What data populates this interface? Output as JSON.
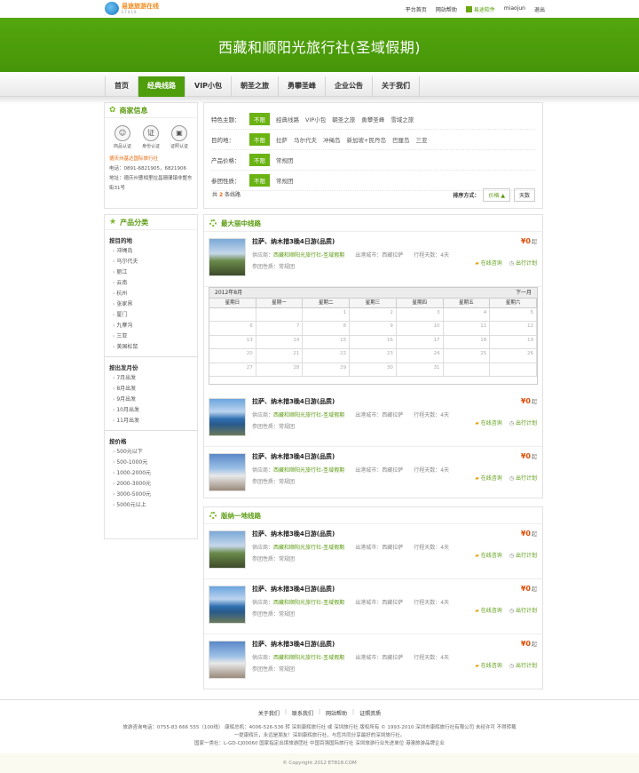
{
  "logo": {
    "name": "易途旅游在线",
    "sub": "ET818"
  },
  "toplinks": [
    "平台首页",
    "网站帮助",
    "易途软件",
    "miaojun",
    "退出"
  ],
  "banner": "西藏和顺阳光旅行社(圣域假期)",
  "nav": [
    "首页",
    "经典线路",
    "VIP小包",
    "朝圣之旅",
    "勇攀圣峰",
    "企业公告",
    "关于我们"
  ],
  "merchant": {
    "title": "商家信息",
    "certs": [
      "商品认证",
      "身份认证",
      "证照认证"
    ],
    "name": "德庆州基达国际旅行社",
    "phone": "电话：0891-6821905，6821906",
    "addr": "地址：德庆州曹相里拉昌珊珊镇非整东街31号"
  },
  "filters": [
    {
      "label": "特色主题：",
      "nolimit": "不限",
      "items": [
        "经典线路",
        "VIP小包",
        "朝圣之旅",
        "勇攀圣峰",
        "雪域之旅"
      ]
    },
    {
      "label": "目的地：",
      "nolimit": "不限",
      "items": [
        "拉萨",
        "马尔代夫",
        "冲绳岛",
        "新加坡+民丹岛",
        "巴厘岛",
        "三亚"
      ]
    },
    {
      "label": "产品价格：",
      "nolimit": "不限",
      "items": [
        "常规团"
      ]
    },
    {
      "label": "参团性质：",
      "nolimit": "不限",
      "items": [
        "常规团"
      ]
    }
  ],
  "count": {
    "pre": "共",
    "num": "2",
    "post": "条线路"
  },
  "sort": {
    "label": "排序方式：",
    "price": "价格",
    "days": "天数"
  },
  "categories": {
    "title": "产品分类",
    "groups": [
      {
        "h": "按目的地",
        "items": [
          "冲绳岛",
          "马尔代夫",
          "丽江",
          "云南",
          "杭州",
          "张家界",
          "厦门",
          "九寨沟",
          "三亚",
          "美国松鼠"
        ]
      },
      {
        "h": "按出发月份",
        "items": [
          "7月出发",
          "8月出发",
          "9月出发",
          "10月出发",
          "11月出发"
        ]
      },
      {
        "h": "按价格",
        "items": [
          "500元以下",
          "500-1000元",
          "1000-2000元",
          "2000-3000元",
          "3000-5000元",
          "5000元以上"
        ]
      }
    ]
  },
  "sections": [
    {
      "title": "最大丽中线路",
      "calendar": {
        "month": "2012年8月",
        "next": "下一月",
        "week": [
          "星期日",
          "星期一",
          "星期二",
          "星期三",
          "星期四",
          "星期五",
          "星期六"
        ],
        "days": [
          "",
          "",
          "1",
          "2",
          "3",
          "4",
          "5",
          "6",
          "7",
          "8",
          "9",
          "10",
          "11",
          "12",
          "13",
          "14",
          "15",
          "16",
          "17",
          "18",
          "19",
          "20",
          "21",
          "22",
          "23",
          "24",
          "25",
          "26",
          "27",
          "28",
          "29",
          "30",
          "31",
          "",
          ""
        ]
      }
    },
    {
      "title": "版纳一地线路"
    }
  ],
  "product": {
    "title": "拉萨、纳木措3晚4日游(品质)",
    "sup_label": "供应商：",
    "sup": "西藏和顺阳光旅行社-圣域假期",
    "city": "出港城市：西藏拉萨",
    "days": "行程天数：4天",
    "nature": "参团性质：常规团",
    "price": "¥0",
    "qi": "起",
    "consult": "在线咨询",
    "plan": "出行计划"
  },
  "footer": {
    "links": [
      "关于我们",
      "联系我们",
      "网站帮助",
      "证照资质"
    ],
    "l1": "旅游咨询电话：0755-83 666 555（100线） 康辉总机：4006-526-536 转 深圳康辉旅行社 或 深圳旅行社 版权所有 © 1993-2010 深圳市康辉旅行社有限公司 未经许可 不得转载",
    "l2": "一提康辉乐，永远是朋友！深圳康辉旅行社，与您共同分享最好的深圳旅行社。",
    "l3": "国家一类社：L-GD-CJ00060 国家指定出境旅游团社 中国百强国际旅行社 深圳旅游行业先进单位 港澳旅游品牌企业",
    "copy": "© Copyright 2012 ET818.COM"
  }
}
